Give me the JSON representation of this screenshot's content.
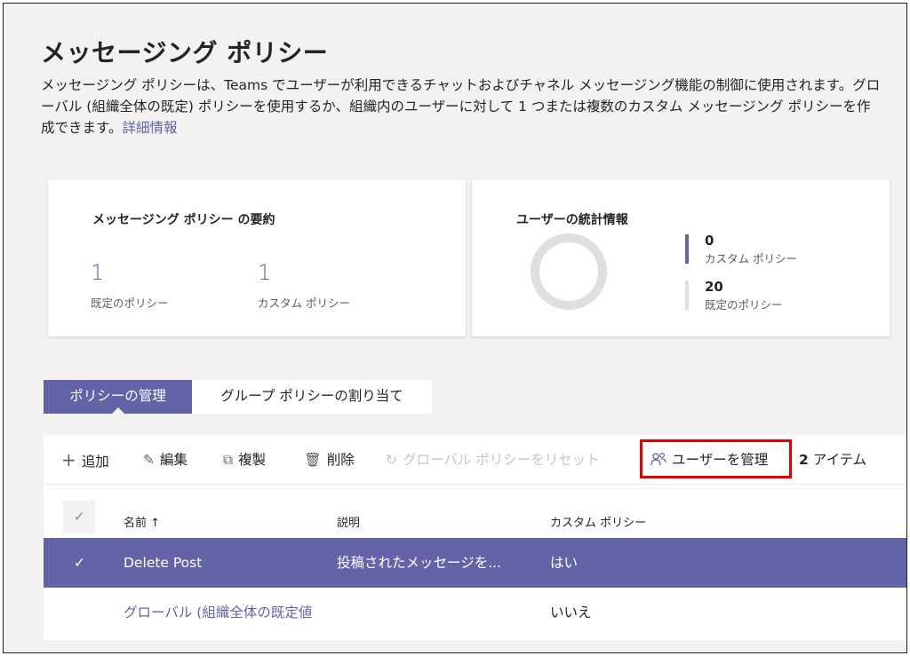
{
  "page": {
    "title": "メッセージング ポリシー",
    "description": "メッセージング ポリシーは、Teams でユーザーが利用できるチャットおよびチャネル メッセージング機能の制御に使用されます。グローバル (組織全体の既定) ポリシーを使用するか、組織内のユーザーに対して 1 つまたは複数のカスタム メッセージング ポリシーを作成できます。",
    "learn_more": "詳細情報"
  },
  "summary": {
    "title": "メッセージング ポリシー の要約",
    "default_count": "1",
    "default_label": "既定のポリシー",
    "custom_count": "1",
    "custom_label": "カスタム ポリシー"
  },
  "user_stats": {
    "title": "ユーザーの統計情報",
    "custom_count": "0",
    "custom_label": "カスタム ポリシー",
    "default_count": "20",
    "default_label": "既定のポリシー",
    "custom_color": "#6264a7",
    "default_color": "#e1dfdd"
  },
  "tabs": [
    {
      "label": "ポリシーの管理",
      "active": true
    },
    {
      "label": "グループ ポリシーの割り当て",
      "active": false
    }
  ],
  "toolbar": {
    "add": "追加",
    "edit": "編集",
    "duplicate": "複製",
    "delete": "削除",
    "reset_global": "グローバル ポリシーをリセット",
    "manage_users": "ユーザーを管理",
    "item_count_num": "2",
    "item_count_label": "アイテム"
  },
  "table": {
    "columns": [
      "名前",
      "説明",
      "カスタム ポリシー"
    ],
    "sort_indicator": "↑",
    "rows": [
      {
        "name": "Delete Post",
        "description": "投稿されたメッセージを...",
        "custom": "はい",
        "selected": true
      },
      {
        "name": "グローバル (組織全体の既定値",
        "description": "",
        "custom": "いいえ",
        "selected": false
      }
    ]
  },
  "colors": {
    "accent": "#6264a7",
    "highlight": "#e60000"
  }
}
